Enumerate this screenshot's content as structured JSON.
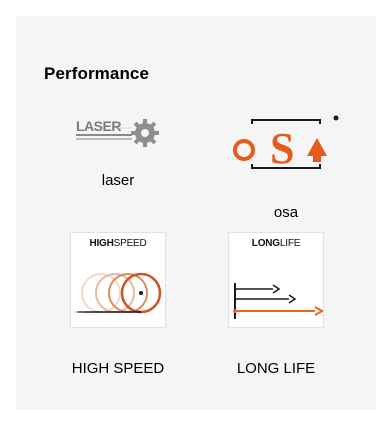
{
  "section": {
    "title": "Performance"
  },
  "features": [
    {
      "id": "laser",
      "label": "laser",
      "icon": "laser-gear-icon"
    },
    {
      "id": "osa",
      "label": "osa",
      "icon": "osa-logo-icon"
    },
    {
      "id": "high-speed",
      "label": "HIGH SPEED",
      "badge_bold": "HIGH",
      "badge_rest": "SPEED",
      "icon": "high-speed-rings-icon"
    },
    {
      "id": "long-life",
      "label": "LONG LIFE",
      "badge_bold": "LONG",
      "badge_rest": "LIFE",
      "icon": "long-life-arrows-icon"
    }
  ],
  "colors": {
    "panel_bg": "#f5f5f5",
    "accent_orange": "#e8661e",
    "ring_brown": "#c9542a",
    "osa_orange": "#e85a1c"
  }
}
